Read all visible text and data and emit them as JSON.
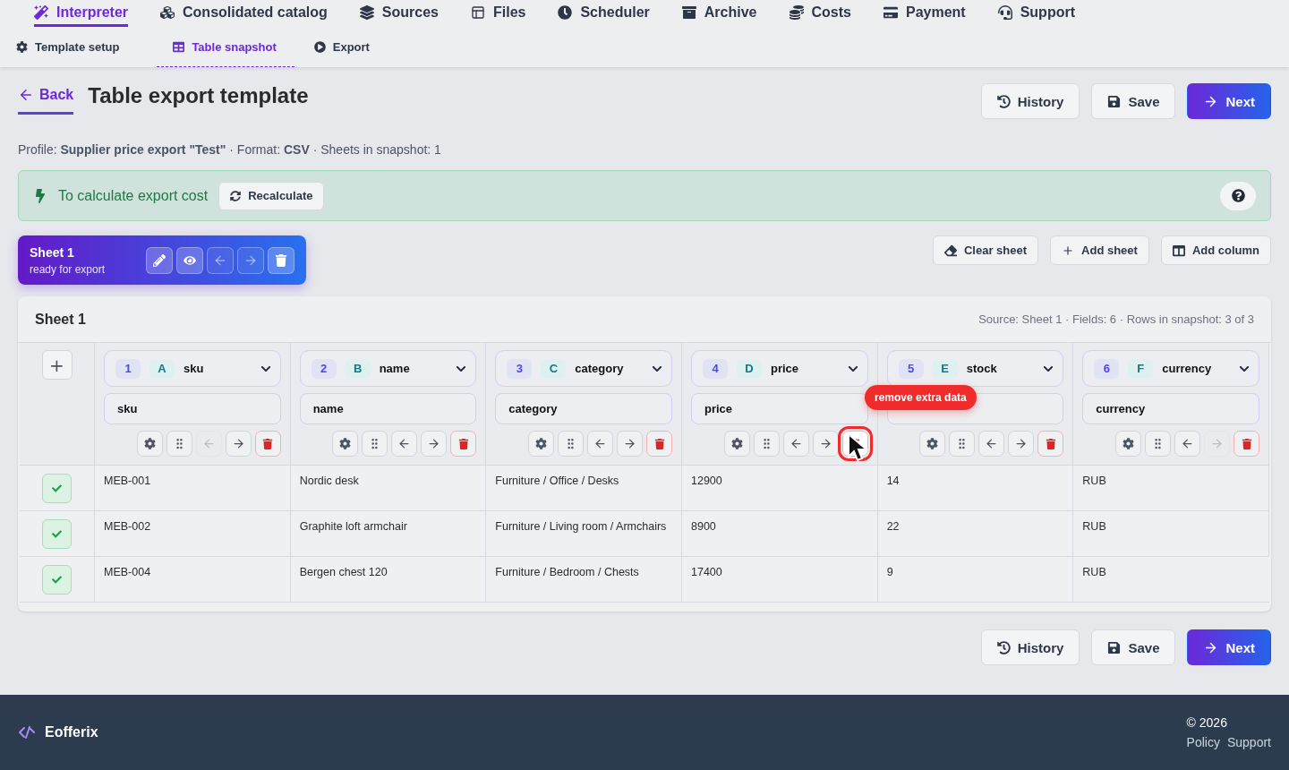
{
  "nav": {
    "items": [
      {
        "label": "Interpreter",
        "selected": true
      },
      {
        "label": "Consolidated catalog",
        "selected": false
      },
      {
        "label": "Sources",
        "selected": false
      },
      {
        "label": "Files",
        "selected": false
      },
      {
        "label": "Scheduler",
        "selected": false
      },
      {
        "label": "Archive",
        "selected": false
      },
      {
        "label": "Costs",
        "selected": false
      },
      {
        "label": "Payment",
        "selected": false
      },
      {
        "label": "Support",
        "selected": false
      }
    ]
  },
  "subtabs": [
    {
      "label": "Template setup",
      "selected": false
    },
    {
      "label": "Table snapshot",
      "selected": true
    },
    {
      "label": "Export",
      "selected": false
    }
  ],
  "header": {
    "back": "Back",
    "title": "Table export template",
    "actions": [
      {
        "label": "History",
        "kind": "history"
      },
      {
        "label": "Save",
        "kind": "save"
      },
      {
        "label": "Next",
        "kind": "next"
      }
    ]
  },
  "profile_line": "Profile: **Supplier price export \"Test\"** · Format: **CSV** · Sheets in snapshot: 1",
  "cost_banner": {
    "text": "To calculate export cost",
    "button": "Recalculate"
  },
  "sheet_card": {
    "title": "Sheet 1",
    "status": "ready for export",
    "tools": [
      {
        "kind": "edit",
        "disabled": false
      },
      {
        "kind": "view",
        "disabled": false
      },
      {
        "kind": "left",
        "disabled": true
      },
      {
        "kind": "right",
        "disabled": true
      },
      {
        "kind": "delete",
        "disabled": false
      }
    ]
  },
  "sheet_actions": [
    {
      "label": "Clear sheet",
      "kind": "clear"
    },
    {
      "label": "Add sheet",
      "kind": "add"
    },
    {
      "label": "Add column",
      "kind": "column"
    }
  ],
  "table": {
    "title": "Sheet 1",
    "meta": "Source: Sheet 1 · Fields: 6 · Rows in snapshot: 3 of 3",
    "add_button": "+",
    "columns": [
      {
        "index": "1",
        "letter": "A",
        "field": "sku",
        "name": "sku",
        "left_disabled": true,
        "right_disabled": false,
        "delete_hovered": false
      },
      {
        "index": "2",
        "letter": "B",
        "field": "name",
        "name": "name",
        "left_disabled": false,
        "right_disabled": false,
        "delete_hovered": false
      },
      {
        "index": "3",
        "letter": "C",
        "field": "category",
        "name": "category",
        "left_disabled": false,
        "right_disabled": false,
        "delete_hovered": false
      },
      {
        "index": "4",
        "letter": "D",
        "field": "price",
        "name": "price",
        "left_disabled": false,
        "right_disabled": false,
        "delete_hovered": true,
        "tooltip": "remove extra data"
      },
      {
        "index": "5",
        "letter": "E",
        "field": "stock",
        "left_disabled": false,
        "right_disabled": false,
        "delete_hovered": false
      },
      {
        "index": "6",
        "letter": "F",
        "field": "currency",
        "name": "currency",
        "left_disabled": false,
        "right_disabled": true,
        "delete_hovered": false
      }
    ],
    "rows": [
      {
        "checked": true,
        "cells": [
          "MEB-001",
          "Nordic desk",
          "Furniture / Office / Desks",
          "12900",
          "14",
          "RUB"
        ]
      },
      {
        "checked": true,
        "cells": [
          "MEB-002",
          "Graphite loft armchair",
          "Furniture / Living room / Armchairs",
          "8900",
          "22",
          "RUB"
        ]
      },
      {
        "checked": true,
        "cells": [
          "MEB-004",
          "Bergen chest 120",
          "Furniture / Bedroom / Chests",
          "17400",
          "9",
          "RUB"
        ]
      }
    ]
  },
  "bottom_actions": [
    {
      "label": "History",
      "kind": "history"
    },
    {
      "label": "Save",
      "kind": "save"
    },
    {
      "label": "Next",
      "kind": "next"
    }
  ],
  "footer": {
    "brand": "Eofferix",
    "copyright": "© 2026",
    "links": [
      "Policy",
      "Support"
    ]
  }
}
